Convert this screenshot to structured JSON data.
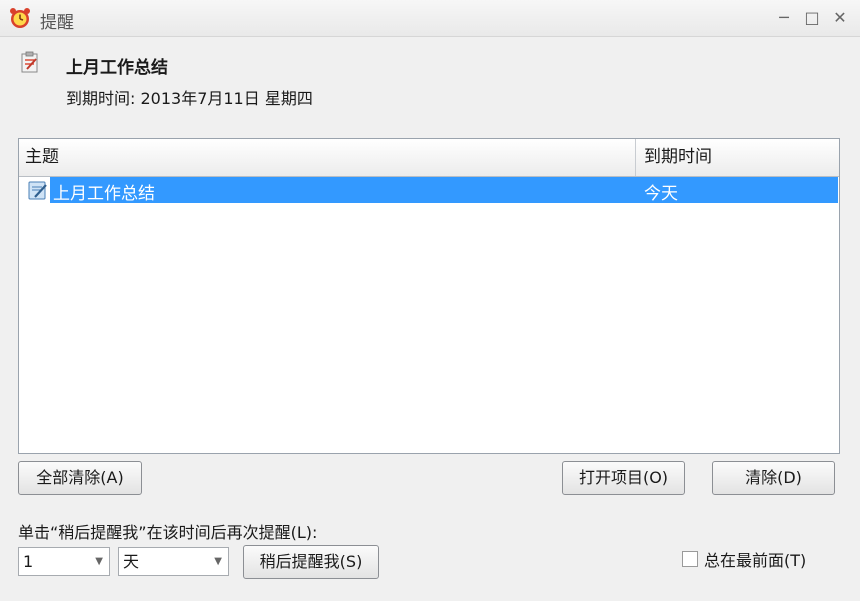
{
  "window": {
    "title": "提醒",
    "minimize_glyph": "─",
    "maximize_glyph": "□",
    "close_glyph": "✕"
  },
  "reminder": {
    "subject": "上月工作总结",
    "due_text": "到期时间: 2013年7月11日 星期四"
  },
  "list": {
    "columns": [
      "主题",
      "到期时间"
    ],
    "rows": [
      {
        "subject": "上月工作总结",
        "due": "今天",
        "selected": true
      }
    ]
  },
  "buttons": {
    "dismiss_all": "全部清除(A)",
    "open_item": "打开项目(O)",
    "dismiss": "清除(D)",
    "snooze": "稍后提醒我(S)"
  },
  "snooze": {
    "prompt": "单击“稍后提醒我”在该时间后再次提醒(L):",
    "amount": "1",
    "unit": "天"
  },
  "options": {
    "always_on_top_label": "总在最前面(T)",
    "always_on_top_checked": false
  },
  "icons": {
    "title": "alarm-clock-icon",
    "task": "task-icon"
  },
  "colors": {
    "selection": "#3399ff",
    "alarm_red": "#d9412b"
  }
}
